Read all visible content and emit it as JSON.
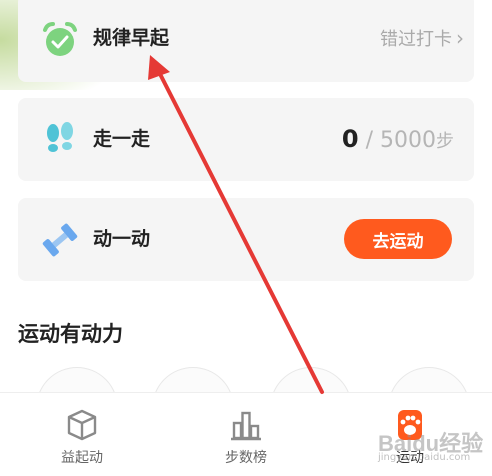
{
  "cards": {
    "early_rise": {
      "title": "规律早起",
      "status": "错过打卡",
      "chevron": "›",
      "icon": "alarm-clock-icon",
      "icon_color": "#7dd37f"
    },
    "walk": {
      "title": "走一走",
      "current_steps": "0",
      "separator": " / ",
      "goal_steps": "5000",
      "unit": "步",
      "icon": "footprints-icon",
      "icon_color": "#4fc3d6"
    },
    "exercise": {
      "title": "动一动",
      "button_label": "去运动",
      "icon": "dumbbell-icon",
      "icon_color": "#6aa8ee",
      "button_color": "#ff5a1e"
    }
  },
  "section": {
    "title": "运动有动力"
  },
  "tabbar": {
    "tabs": [
      {
        "label": "益起动",
        "icon": "box-icon"
      },
      {
        "label": "步数榜",
        "icon": "bar-chart-icon"
      },
      {
        "label": "运动",
        "icon": "paw-icon",
        "active": true,
        "active_color": "#ff5a1e"
      }
    ]
  },
  "watermark": {
    "text": "Baidu经验",
    "sub": "jingyan.baidu.com"
  },
  "annotation": {
    "arrow_color": "#e53935"
  }
}
